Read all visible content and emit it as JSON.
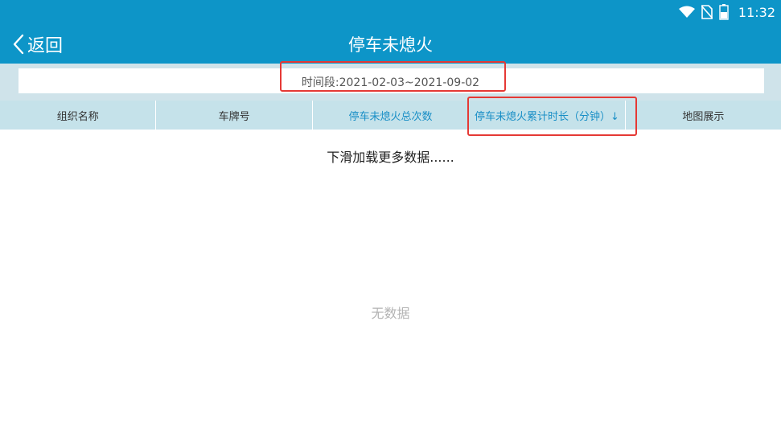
{
  "status_bar": {
    "time": "11:32",
    "icons": [
      "wifi-icon",
      "no-sim-icon",
      "battery-icon"
    ]
  },
  "header": {
    "back_label": "返回",
    "title": "停车未熄火"
  },
  "filter": {
    "period_text": "时间段:2021-02-03~2021-09-02"
  },
  "table": {
    "columns": [
      "组织名称",
      "车牌号",
      "停车未熄火总次数",
      "停车未熄火累计时长（分钟）↓",
      "地图展示"
    ],
    "active_column_index": 3
  },
  "list": {
    "load_more": "下滑加载更多数据......",
    "empty_text": "无数据"
  },
  "colors": {
    "header_bg": "#0d95c8",
    "table_header_bg": "#c5e2ea",
    "accent_text": "#1a8fc6",
    "highlight": "#e53935"
  }
}
